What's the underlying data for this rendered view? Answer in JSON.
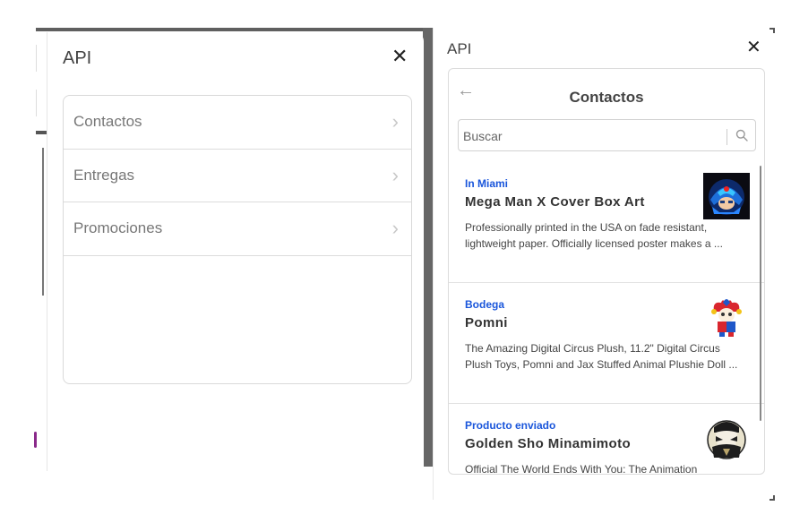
{
  "left_panel": {
    "title": "API",
    "close_glyph": "✕",
    "items": [
      {
        "label": "Contactos"
      },
      {
        "label": "Entregas"
      },
      {
        "label": "Promociones"
      }
    ],
    "chevron_glyph": "›"
  },
  "right_panel": {
    "title": "API",
    "close_glyph": "✕",
    "back_glyph": "←",
    "heading": "Contactos",
    "search": {
      "placeholder": "Buscar",
      "value": ""
    },
    "items": [
      {
        "tag": "In Miami",
        "name": "Mega Man X Cover Box Art",
        "description": "Professionally printed in the USA on fade resistant, lightweight paper. Officially licensed poster makes a ...",
        "thumbnail": "mega-man-x-thumbnail"
      },
      {
        "tag": "Bodega",
        "name": "Pomni",
        "description": "The Amazing Digital Circus Plush, 11.2\" Digital Circus Plush Toys, Pomni and Jax Stuffed Animal Plushie Doll ...",
        "thumbnail": "pomni-plush-thumbnail"
      },
      {
        "tag": "Producto enviado",
        "name": "Golden Sho Minamimoto",
        "description": "Official The World Ends With You: The Animation",
        "thumbnail": "sho-minamimoto-thumbnail"
      }
    ]
  },
  "colors": {
    "tag_blue": "#1a56db",
    "frame_dark": "#666666"
  }
}
